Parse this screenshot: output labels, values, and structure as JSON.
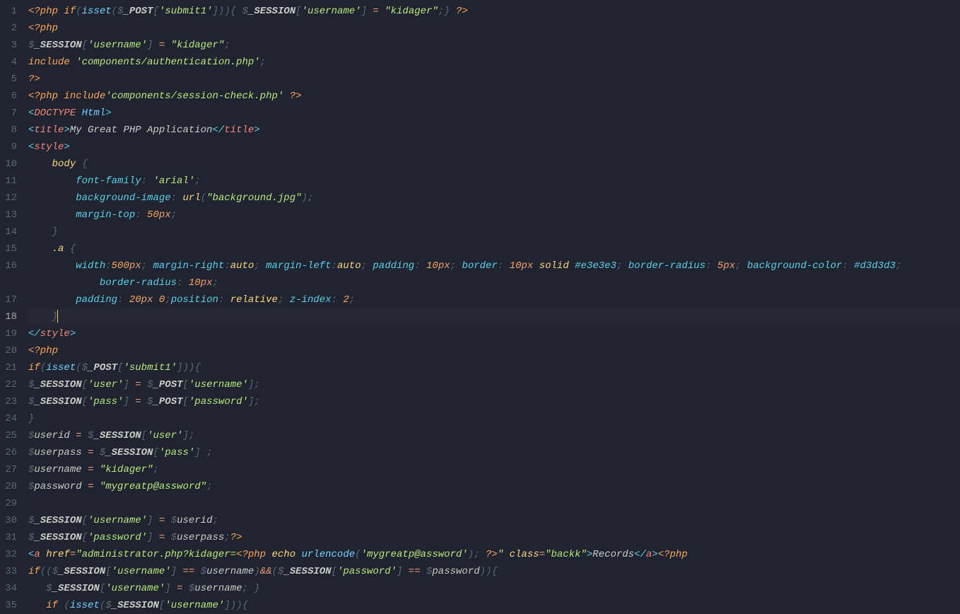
{
  "activeLine": 18,
  "lines": {
    "l1": [
      {
        "t": "<?php ",
        "c": "t-phptag"
      },
      {
        "t": "if",
        "c": "t-keyword"
      },
      {
        "t": "(",
        "c": "t-punct"
      },
      {
        "t": "isset",
        "c": "t-func"
      },
      {
        "t": "(",
        "c": "t-punct"
      },
      {
        "t": "$",
        "c": "t-punct"
      },
      {
        "t": "_POST",
        "c": "t-global"
      },
      {
        "t": "[",
        "c": "t-punct"
      },
      {
        "t": "'submit1'",
        "c": "t-string"
      },
      {
        "t": "]",
        "c": "t-punct"
      },
      {
        "t": ")",
        "c": "t-punct"
      },
      {
        "t": ")",
        "c": "t-punct"
      },
      {
        "t": "{",
        "c": "t-punct"
      },
      {
        "t": " ",
        "c": ""
      },
      {
        "t": "$",
        "c": "t-punct"
      },
      {
        "t": "_SESSION",
        "c": "t-global"
      },
      {
        "t": "[",
        "c": "t-punct"
      },
      {
        "t": "'username'",
        "c": "t-string"
      },
      {
        "t": "]",
        "c": "t-punct"
      },
      {
        "t": " = ",
        "c": "t-op"
      },
      {
        "t": "\"kidager\"",
        "c": "t-string"
      },
      {
        "t": ";",
        "c": "t-punct"
      },
      {
        "t": "}",
        "c": "t-punct"
      },
      {
        "t": " ?>",
        "c": "t-phptag"
      }
    ],
    "l2": [
      {
        "t": "<?php",
        "c": "t-phptag"
      }
    ],
    "l3": [
      {
        "t": "$",
        "c": "t-punct"
      },
      {
        "t": "_SESSION",
        "c": "t-global"
      },
      {
        "t": "[",
        "c": "t-punct"
      },
      {
        "t": "'username'",
        "c": "t-string"
      },
      {
        "t": "]",
        "c": "t-punct"
      },
      {
        "t": " = ",
        "c": "t-op"
      },
      {
        "t": "\"kidager\"",
        "c": "t-string"
      },
      {
        "t": ";",
        "c": "t-punct"
      }
    ],
    "l4": [
      {
        "t": "include ",
        "c": "t-keyword"
      },
      {
        "t": "'components/authentication.php'",
        "c": "t-string"
      },
      {
        "t": ";",
        "c": "t-punct"
      }
    ],
    "l5": [
      {
        "t": "?>",
        "c": "t-phptag"
      }
    ],
    "l6": [
      {
        "t": "<?php ",
        "c": "t-phptag"
      },
      {
        "t": "include",
        "c": "t-keyword"
      },
      {
        "t": "'components/session-check.php'",
        "c": "t-string"
      },
      {
        "t": " ?>",
        "c": "t-phptag"
      }
    ],
    "l7": [
      {
        "t": "<",
        "c": "t-tag"
      },
      {
        "t": "DOCTYPE ",
        "c": "t-tagname"
      },
      {
        "t": "Html",
        "c": "t-tagname2"
      },
      {
        "t": ">",
        "c": "t-tag"
      }
    ],
    "l8": [
      {
        "t": "<",
        "c": "t-tag"
      },
      {
        "t": "title",
        "c": "t-tagname"
      },
      {
        "t": ">",
        "c": "t-tag"
      },
      {
        "t": "My Great PHP Application",
        "c": "t-text"
      },
      {
        "t": "</",
        "c": "t-tag"
      },
      {
        "t": "title",
        "c": "t-tagname"
      },
      {
        "t": ">",
        "c": "t-tag"
      }
    ],
    "l9": [
      {
        "t": "<",
        "c": "t-tag"
      },
      {
        "t": "style",
        "c": "t-tagname"
      },
      {
        "t": ">",
        "c": "t-tag"
      }
    ],
    "l10": [
      {
        "t": "    ",
        "c": ""
      },
      {
        "t": "body",
        "c": "t-selector"
      },
      {
        "t": " {",
        "c": "t-brace"
      }
    ],
    "l11": [
      {
        "t": "        ",
        "c": ""
      },
      {
        "t": "font-family",
        "c": "t-prop"
      },
      {
        "t": ": ",
        "c": "t-punct"
      },
      {
        "t": "'arial'",
        "c": "t-string"
      },
      {
        "t": ";",
        "c": "t-punct"
      }
    ],
    "l12": [
      {
        "t": "        ",
        "c": ""
      },
      {
        "t": "background-image",
        "c": "t-prop"
      },
      {
        "t": ": ",
        "c": "t-punct"
      },
      {
        "t": "url",
        "c": "t-funccall"
      },
      {
        "t": "(",
        "c": "t-punct"
      },
      {
        "t": "\"background.jpg\"",
        "c": "t-string"
      },
      {
        "t": ")",
        "c": "t-punct"
      },
      {
        "t": ";",
        "c": "t-punct"
      }
    ],
    "l13": [
      {
        "t": "        ",
        "c": ""
      },
      {
        "t": "margin-top",
        "c": "t-prop"
      },
      {
        "t": ": ",
        "c": "t-punct"
      },
      {
        "t": "50",
        "c": "t-number"
      },
      {
        "t": "px",
        "c": "t-unit"
      },
      {
        "t": ";",
        "c": "t-punct"
      }
    ],
    "l14": [
      {
        "t": "    ",
        "c": ""
      },
      {
        "t": "}",
        "c": "t-brace"
      }
    ],
    "l15": [
      {
        "t": "    ",
        "c": ""
      },
      {
        "t": ".a",
        "c": "t-selector"
      },
      {
        "t": " {",
        "c": "t-brace"
      }
    ],
    "l16a": [
      {
        "t": "        ",
        "c": ""
      },
      {
        "t": "width",
        "c": "t-prop"
      },
      {
        "t": ":",
        "c": "t-punct"
      },
      {
        "t": "500",
        "c": "t-number"
      },
      {
        "t": "px",
        "c": "t-unit"
      },
      {
        "t": "; ",
        "c": "t-punct"
      },
      {
        "t": "margin-right",
        "c": "t-prop"
      },
      {
        "t": ":",
        "c": "t-punct"
      },
      {
        "t": "auto",
        "c": "t-funccall"
      },
      {
        "t": "; ",
        "c": "t-punct"
      },
      {
        "t": "margin-left",
        "c": "t-prop"
      },
      {
        "t": ":",
        "c": "t-punct"
      },
      {
        "t": "auto",
        "c": "t-funccall"
      },
      {
        "t": "; ",
        "c": "t-punct"
      },
      {
        "t": "padding",
        "c": "t-prop"
      },
      {
        "t": ": ",
        "c": "t-punct"
      },
      {
        "t": "10",
        "c": "t-number"
      },
      {
        "t": "px",
        "c": "t-unit"
      },
      {
        "t": "; ",
        "c": "t-punct"
      },
      {
        "t": "border",
        "c": "t-prop"
      },
      {
        "t": ": ",
        "c": "t-punct"
      },
      {
        "t": "10",
        "c": "t-number"
      },
      {
        "t": "px ",
        "c": "t-unit"
      },
      {
        "t": "solid ",
        "c": "t-funccall"
      },
      {
        "t": "#e3e3e3",
        "c": "t-hex"
      },
      {
        "t": "; ",
        "c": "t-punct"
      },
      {
        "t": "border-radius",
        "c": "t-prop"
      },
      {
        "t": ": ",
        "c": "t-punct"
      },
      {
        "t": "5",
        "c": "t-number"
      },
      {
        "t": "px",
        "c": "t-unit"
      },
      {
        "t": "; ",
        "c": "t-punct"
      },
      {
        "t": "background-color",
        "c": "t-prop"
      },
      {
        "t": ": ",
        "c": "t-punct"
      },
      {
        "t": "#d3d3d3",
        "c": "t-hex"
      },
      {
        "t": ";",
        "c": "t-punct"
      }
    ],
    "l16b": [
      {
        "t": "            ",
        "c": ""
      },
      {
        "t": "border-radius",
        "c": "t-prop"
      },
      {
        "t": ": ",
        "c": "t-punct"
      },
      {
        "t": "10",
        "c": "t-number"
      },
      {
        "t": "px",
        "c": "t-unit"
      },
      {
        "t": ";",
        "c": "t-punct"
      }
    ],
    "l17": [
      {
        "t": "        ",
        "c": ""
      },
      {
        "t": "padding",
        "c": "t-prop"
      },
      {
        "t": ": ",
        "c": "t-punct"
      },
      {
        "t": "20",
        "c": "t-number"
      },
      {
        "t": "px ",
        "c": "t-unit"
      },
      {
        "t": "0",
        "c": "t-number"
      },
      {
        "t": ";",
        "c": "t-punct"
      },
      {
        "t": "position",
        "c": "t-prop"
      },
      {
        "t": ": ",
        "c": "t-punct"
      },
      {
        "t": "relative",
        "c": "t-funccall"
      },
      {
        "t": "; ",
        "c": "t-punct"
      },
      {
        "t": "z-index",
        "c": "t-prop"
      },
      {
        "t": ": ",
        "c": "t-punct"
      },
      {
        "t": "2",
        "c": "t-number"
      },
      {
        "t": ";",
        "c": "t-punct"
      }
    ],
    "l18": [
      {
        "t": "    ",
        "c": ""
      },
      {
        "t": "}",
        "c": "t-brace"
      }
    ],
    "l19": [
      {
        "t": "</",
        "c": "t-tag"
      },
      {
        "t": "style",
        "c": "t-tagname"
      },
      {
        "t": ">",
        "c": "t-tag"
      }
    ],
    "l20": [
      {
        "t": "<?php",
        "c": "t-phptag"
      }
    ],
    "l21": [
      {
        "t": "if",
        "c": "t-keyword"
      },
      {
        "t": "(",
        "c": "t-punct"
      },
      {
        "t": "isset",
        "c": "t-func"
      },
      {
        "t": "(",
        "c": "t-punct"
      },
      {
        "t": "$",
        "c": "t-punct"
      },
      {
        "t": "_POST",
        "c": "t-global"
      },
      {
        "t": "[",
        "c": "t-punct"
      },
      {
        "t": "'submit1'",
        "c": "t-string"
      },
      {
        "t": "]",
        "c": "t-punct"
      },
      {
        "t": ")",
        "c": "t-punct"
      },
      {
        "t": ")",
        "c": "t-punct"
      },
      {
        "t": "{",
        "c": "t-punct"
      }
    ],
    "l22": [
      {
        "t": "$",
        "c": "t-punct"
      },
      {
        "t": "_SESSION",
        "c": "t-global"
      },
      {
        "t": "[",
        "c": "t-punct"
      },
      {
        "t": "'user'",
        "c": "t-string"
      },
      {
        "t": "]",
        "c": "t-punct"
      },
      {
        "t": " = ",
        "c": "t-op"
      },
      {
        "t": "$",
        "c": "t-punct"
      },
      {
        "t": "_POST",
        "c": "t-global"
      },
      {
        "t": "[",
        "c": "t-punct"
      },
      {
        "t": "'username'",
        "c": "t-string"
      },
      {
        "t": "]",
        "c": "t-punct"
      },
      {
        "t": ";",
        "c": "t-punct"
      }
    ],
    "l23": [
      {
        "t": "$",
        "c": "t-punct"
      },
      {
        "t": "_SESSION",
        "c": "t-global"
      },
      {
        "t": "[",
        "c": "t-punct"
      },
      {
        "t": "'pass'",
        "c": "t-string"
      },
      {
        "t": "]",
        "c": "t-punct"
      },
      {
        "t": " = ",
        "c": "t-op"
      },
      {
        "t": "$",
        "c": "t-punct"
      },
      {
        "t": "_POST",
        "c": "t-global"
      },
      {
        "t": "[",
        "c": "t-punct"
      },
      {
        "t": "'password'",
        "c": "t-string"
      },
      {
        "t": "]",
        "c": "t-punct"
      },
      {
        "t": ";",
        "c": "t-punct"
      }
    ],
    "l24": [
      {
        "t": "}",
        "c": "t-punct"
      }
    ],
    "l25": [
      {
        "t": "$",
        "c": "t-punct"
      },
      {
        "t": "userid",
        "c": "t-var"
      },
      {
        "t": " = ",
        "c": "t-op"
      },
      {
        "t": "$",
        "c": "t-punct"
      },
      {
        "t": "_SESSION",
        "c": "t-global"
      },
      {
        "t": "[",
        "c": "t-punct"
      },
      {
        "t": "'user'",
        "c": "t-string"
      },
      {
        "t": "]",
        "c": "t-punct"
      },
      {
        "t": ";",
        "c": "t-punct"
      }
    ],
    "l26": [
      {
        "t": "$",
        "c": "t-punct"
      },
      {
        "t": "userpass",
        "c": "t-var"
      },
      {
        "t": " = ",
        "c": "t-op"
      },
      {
        "t": "$",
        "c": "t-punct"
      },
      {
        "t": "_SESSION",
        "c": "t-global"
      },
      {
        "t": "[",
        "c": "t-punct"
      },
      {
        "t": "'pass'",
        "c": "t-string"
      },
      {
        "t": "]",
        "c": "t-punct"
      },
      {
        "t": " ;",
        "c": "t-punct"
      }
    ],
    "l27": [
      {
        "t": "$",
        "c": "t-punct"
      },
      {
        "t": "username",
        "c": "t-var"
      },
      {
        "t": " = ",
        "c": "t-op"
      },
      {
        "t": "\"kidager\"",
        "c": "t-string"
      },
      {
        "t": ";",
        "c": "t-punct"
      }
    ],
    "l28": [
      {
        "t": "$",
        "c": "t-punct"
      },
      {
        "t": "password",
        "c": "t-var"
      },
      {
        "t": " = ",
        "c": "t-op"
      },
      {
        "t": "\"mygreatp@assword\"",
        "c": "t-string"
      },
      {
        "t": ";",
        "c": "t-punct"
      }
    ],
    "l29": [],
    "l30": [
      {
        "t": "$",
        "c": "t-punct"
      },
      {
        "t": "_SESSION",
        "c": "t-global"
      },
      {
        "t": "[",
        "c": "t-punct"
      },
      {
        "t": "'username'",
        "c": "t-string"
      },
      {
        "t": "]",
        "c": "t-punct"
      },
      {
        "t": " = ",
        "c": "t-op"
      },
      {
        "t": "$",
        "c": "t-punct"
      },
      {
        "t": "userid",
        "c": "t-var"
      },
      {
        "t": ";",
        "c": "t-punct"
      }
    ],
    "l31": [
      {
        "t": "$",
        "c": "t-punct"
      },
      {
        "t": "_SESSION",
        "c": "t-global"
      },
      {
        "t": "[",
        "c": "t-punct"
      },
      {
        "t": "'password'",
        "c": "t-string"
      },
      {
        "t": "]",
        "c": "t-punct"
      },
      {
        "t": " = ",
        "c": "t-op"
      },
      {
        "t": "$",
        "c": "t-punct"
      },
      {
        "t": "userpass",
        "c": "t-var"
      },
      {
        "t": ";",
        "c": "t-punct"
      },
      {
        "t": "?>",
        "c": "t-phptag"
      }
    ],
    "l32": [
      {
        "t": "<",
        "c": "t-tag"
      },
      {
        "t": "a ",
        "c": "t-tagname"
      },
      {
        "t": "href",
        "c": "t-attr"
      },
      {
        "t": "=",
        "c": "t-op"
      },
      {
        "t": "\"administrator.php?kidager=",
        "c": "t-string"
      },
      {
        "t": "<?php ",
        "c": "t-phptag"
      },
      {
        "t": "echo ",
        "c": "t-funccall"
      },
      {
        "t": "urlencode",
        "c": "t-func"
      },
      {
        "t": "(",
        "c": "t-punct"
      },
      {
        "t": "'mygreatp@assword'",
        "c": "t-string"
      },
      {
        "t": ")",
        "c": "t-punct"
      },
      {
        "t": "; ",
        "c": "t-punct"
      },
      {
        "t": "?>",
        "c": "t-phptag"
      },
      {
        "t": "\"",
        "c": "t-string"
      },
      {
        "t": " ",
        "c": ""
      },
      {
        "t": "class",
        "c": "t-attr"
      },
      {
        "t": "=",
        "c": "t-op"
      },
      {
        "t": "\"backk\"",
        "c": "t-string"
      },
      {
        "t": ">",
        "c": "t-tag"
      },
      {
        "t": "Records",
        "c": "t-text"
      },
      {
        "t": "</",
        "c": "t-tag"
      },
      {
        "t": "a",
        "c": "t-tagname"
      },
      {
        "t": ">",
        "c": "t-tag"
      },
      {
        "t": "<?php",
        "c": "t-phptag"
      }
    ],
    "l33": [
      {
        "t": "if",
        "c": "t-keyword"
      },
      {
        "t": "((",
        "c": "t-punct"
      },
      {
        "t": "$",
        "c": "t-punct"
      },
      {
        "t": "_SESSION",
        "c": "t-global"
      },
      {
        "t": "[",
        "c": "t-punct"
      },
      {
        "t": "'username'",
        "c": "t-string"
      },
      {
        "t": "]",
        "c": "t-punct"
      },
      {
        "t": " == ",
        "c": "t-op"
      },
      {
        "t": "$",
        "c": "t-punct"
      },
      {
        "t": "username",
        "c": "t-var"
      },
      {
        "t": ")",
        "c": "t-punct"
      },
      {
        "t": "&&",
        "c": "t-op"
      },
      {
        "t": "(",
        "c": "t-punct"
      },
      {
        "t": "$",
        "c": "t-punct"
      },
      {
        "t": "_SESSION",
        "c": "t-global"
      },
      {
        "t": "[",
        "c": "t-punct"
      },
      {
        "t": "'password'",
        "c": "t-string"
      },
      {
        "t": "]",
        "c": "t-punct"
      },
      {
        "t": " == ",
        "c": "t-op"
      },
      {
        "t": "$",
        "c": "t-punct"
      },
      {
        "t": "password",
        "c": "t-var"
      },
      {
        "t": ")",
        "c": "t-punct"
      },
      {
        "t": ")",
        "c": "t-punct"
      },
      {
        "t": "{",
        "c": "t-punct"
      }
    ],
    "l34": [
      {
        "t": "   ",
        "c": ""
      },
      {
        "t": "$",
        "c": "t-punct"
      },
      {
        "t": "_SESSION",
        "c": "t-global"
      },
      {
        "t": "[",
        "c": "t-punct"
      },
      {
        "t": "'username'",
        "c": "t-string"
      },
      {
        "t": "]",
        "c": "t-punct"
      },
      {
        "t": " = ",
        "c": "t-op"
      },
      {
        "t": "$",
        "c": "t-punct"
      },
      {
        "t": "username",
        "c": "t-var"
      },
      {
        "t": "; ",
        "c": "t-punct"
      },
      {
        "t": "}",
        "c": "t-punct"
      }
    ],
    "l35": [
      {
        "t": "   ",
        "c": ""
      },
      {
        "t": "if ",
        "c": "t-keyword"
      },
      {
        "t": "(",
        "c": "t-punct"
      },
      {
        "t": "isset",
        "c": "t-func"
      },
      {
        "t": "(",
        "c": "t-punct"
      },
      {
        "t": "$",
        "c": "t-punct"
      },
      {
        "t": "_SESSION",
        "c": "t-global"
      },
      {
        "t": "[",
        "c": "t-punct"
      },
      {
        "t": "'username'",
        "c": "t-string"
      },
      {
        "t": "]",
        "c": "t-punct"
      },
      {
        "t": ")",
        "c": "t-punct"
      },
      {
        "t": ")",
        "c": "t-punct"
      },
      {
        "t": "{",
        "c": "t-punct"
      }
    ]
  },
  "lineOrder": [
    "l1",
    "l2",
    "l3",
    "l4",
    "l5",
    "l6",
    "l7",
    "l8",
    "l9",
    "l10",
    "l11",
    "l12",
    "l13",
    "l14",
    "l15",
    "l16a",
    "l16b",
    "l17",
    "l18",
    "l19",
    "l20",
    "l21",
    "l22",
    "l23",
    "l24",
    "l25",
    "l26",
    "l27",
    "l28",
    "l29",
    "l30",
    "l31",
    "l32",
    "l33",
    "l34",
    "l35"
  ],
  "lineNumbers": [
    1,
    2,
    3,
    4,
    5,
    6,
    7,
    8,
    9,
    10,
    11,
    12,
    13,
    14,
    15,
    16,
    null,
    17,
    18,
    19,
    20,
    21,
    22,
    23,
    24,
    25,
    26,
    27,
    28,
    29,
    30,
    31,
    32,
    33,
    34,
    35
  ]
}
